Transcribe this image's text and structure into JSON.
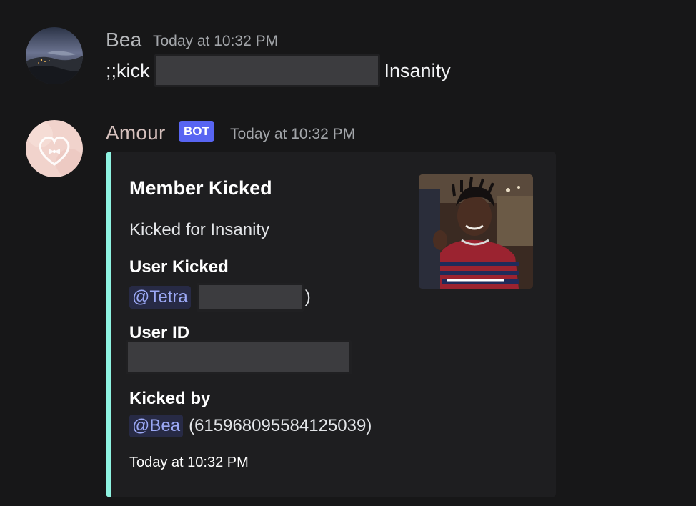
{
  "messages": [
    {
      "author": "Bea",
      "author_color": "#b5b7ba",
      "timestamp": "Today at 10:32 PM",
      "text_prefix": ";;kick",
      "text_suffix": "Insanity"
    },
    {
      "author": "Amour",
      "author_color": "#d6c1bd",
      "bot_tag": "BOT",
      "timestamp": "Today at 10:32 PM",
      "embed": {
        "accent_color": "#8ff3e1",
        "title": "Member Kicked",
        "description": "Kicked for Insanity",
        "fields": [
          {
            "name": "User Kicked",
            "mention": "@Tetra",
            "suffix": ")"
          },
          {
            "name": "User ID"
          },
          {
            "name": "Kicked by",
            "mention": "@Bea",
            "suffix": "(615968095584125039)"
          }
        ],
        "footer": "Today at 10:32 PM"
      }
    }
  ]
}
